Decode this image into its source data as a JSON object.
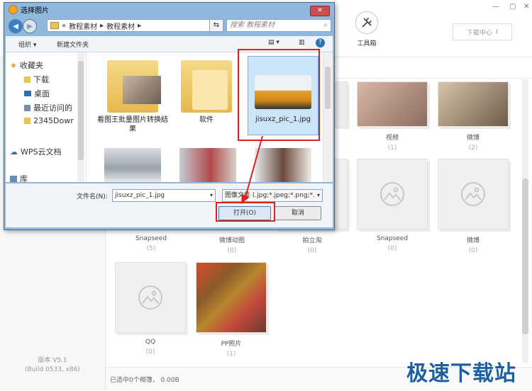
{
  "app": {
    "toolbox_label": "工具箱",
    "download_center": "下载中心",
    "version": "版本 V5.1",
    "build": "(Build 0533, x86)",
    "status": "已选中0个相簿， 0.00B",
    "albums": [
      {
        "name": "视频",
        "count": "(1)"
      },
      {
        "name": "微博",
        "count": "(2)"
      },
      {
        "name": "Snapseed",
        "count": "(5)"
      },
      {
        "name": "微博动图",
        "count": "(0)"
      },
      {
        "name": "拍立淘",
        "count": "(0)"
      },
      {
        "name": "Snapseed",
        "count": "(0)"
      },
      {
        "name": "微博",
        "count": "(0)"
      },
      {
        "name": "QQ",
        "count": "(0)"
      },
      {
        "name": "PP照片",
        "count": "(1)"
      }
    ]
  },
  "dialog": {
    "title": "选择图片",
    "address": {
      "prefix": "«",
      "segments": [
        "教程素材",
        "教程素材"
      ]
    },
    "search_placeholder": "搜索 教程素材",
    "toolbar": {
      "organize": "组织 ▾",
      "new_folder": "新建文件夹"
    },
    "nav_items": [
      "收藏夹",
      "下载",
      "桌面",
      "最近访问的",
      "2345Dowr",
      "WPS云文档",
      "库"
    ],
    "files": [
      {
        "name": "看图王批量图片转换结果"
      },
      {
        "name": "软件"
      },
      {
        "name": "jisuxz_pic_1.jpg"
      }
    ],
    "filename_label": "文件名(N):",
    "filename_value": "jisuxz_pic_1.jpg",
    "filetype_value": "图像文件 (.jpg;*.jpeg;*.png;*.",
    "open_label": "打开(O)",
    "cancel_label": "取消"
  },
  "watermark": "极速下载站",
  "colors": {
    "highlight_red": "#e02020",
    "selection_blue": "#cce4f7",
    "dialog_frame": "#8fb8dc"
  }
}
